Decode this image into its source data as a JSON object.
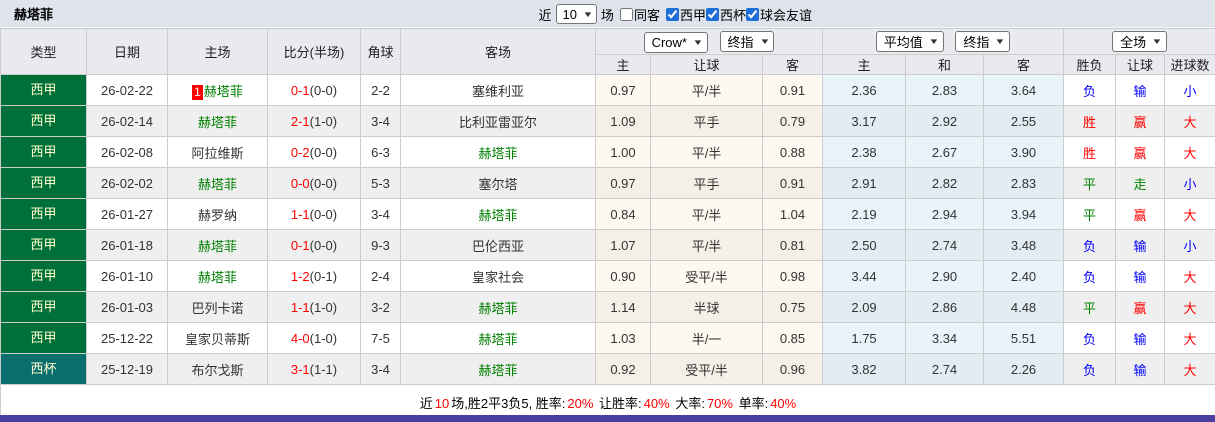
{
  "title": "赫塔菲",
  "filter": {
    "recent_prefix": "近",
    "recent_value": "10",
    "recent_suffix": "场",
    "checkboxes": [
      {
        "label": "同客",
        "checked": false
      },
      {
        "label": "西甲",
        "checked": true
      },
      {
        "label": "西杯",
        "checked": true
      },
      {
        "label": "球会友谊",
        "checked": true
      }
    ]
  },
  "header": {
    "cols": [
      "类型",
      "日期",
      "主场",
      "比分(半场)",
      "角球",
      "客场"
    ],
    "bookmaker_select": "Crow*",
    "final_select_1": "终指",
    "average_select": "平均值",
    "final_select_2": "终指",
    "scope_select": "全场",
    "odds_subcols": [
      "主",
      "让球",
      "客"
    ],
    "avg_subcols": [
      "主",
      "和",
      "客"
    ],
    "result_subcols": [
      "胜负",
      "让球",
      "进球数"
    ]
  },
  "rows": [
    {
      "league": "西甲",
      "league_class": "liga",
      "date": "26-02-22",
      "home": {
        "name": "赫塔菲",
        "target": true,
        "rank": "1"
      },
      "score": {
        "ft": "0-1",
        "ht": "(0-0)"
      },
      "corner": "2-2",
      "away": {
        "name": "塞维利亚",
        "target": false
      },
      "odds": [
        "0.97",
        "平/半",
        "0.91"
      ],
      "avg": [
        "2.36",
        "2.83",
        "3.64"
      ],
      "res": [
        {
          "t": "负",
          "c": "c-blue"
        },
        {
          "t": "输",
          "c": "c-blue"
        },
        {
          "t": "小",
          "c": "c-blue"
        }
      ]
    },
    {
      "league": "西甲",
      "league_class": "liga",
      "date": "26-02-14",
      "home": {
        "name": "赫塔菲",
        "target": true
      },
      "score": {
        "ft": "2-1",
        "ht": "(1-0)"
      },
      "corner": "3-4",
      "away": {
        "name": "比利亚雷亚尔",
        "target": false
      },
      "odds": [
        "1.09",
        "平手",
        "0.79"
      ],
      "avg": [
        "3.17",
        "2.92",
        "2.55"
      ],
      "res": [
        {
          "t": "胜",
          "c": "c-red"
        },
        {
          "t": "赢",
          "c": "c-red"
        },
        {
          "t": "大",
          "c": "c-red"
        }
      ]
    },
    {
      "league": "西甲",
      "league_class": "liga",
      "date": "26-02-08",
      "home": {
        "name": "阿拉维斯",
        "target": false
      },
      "score": {
        "ft": "0-2",
        "ht": "(0-0)"
      },
      "corner": "6-3",
      "away": {
        "name": "赫塔菲",
        "target": true
      },
      "odds": [
        "1.00",
        "平/半",
        "0.88"
      ],
      "avg": [
        "2.38",
        "2.67",
        "3.90"
      ],
      "res": [
        {
          "t": "胜",
          "c": "c-red"
        },
        {
          "t": "赢",
          "c": "c-red"
        },
        {
          "t": "大",
          "c": "c-red"
        }
      ]
    },
    {
      "league": "西甲",
      "league_class": "liga",
      "date": "26-02-02",
      "home": {
        "name": "赫塔菲",
        "target": true
      },
      "score": {
        "ft": "0-0",
        "ht": "(0-0)"
      },
      "corner": "5-3",
      "away": {
        "name": "塞尔塔",
        "target": false
      },
      "odds": [
        "0.97",
        "平手",
        "0.91"
      ],
      "avg": [
        "2.91",
        "2.82",
        "2.83"
      ],
      "res": [
        {
          "t": "平",
          "c": "c-green"
        },
        {
          "t": "走",
          "c": "c-green"
        },
        {
          "t": "小",
          "c": "c-blue"
        }
      ]
    },
    {
      "league": "西甲",
      "league_class": "liga",
      "date": "26-01-27",
      "home": {
        "name": "赫罗纳",
        "target": false
      },
      "score": {
        "ft": "1-1",
        "ht": "(0-0)"
      },
      "corner": "3-4",
      "away": {
        "name": "赫塔菲",
        "target": true
      },
      "odds": [
        "0.84",
        "平/半",
        "1.04"
      ],
      "avg": [
        "2.19",
        "2.94",
        "3.94"
      ],
      "res": [
        {
          "t": "平",
          "c": "c-green"
        },
        {
          "t": "赢",
          "c": "c-red"
        },
        {
          "t": "大",
          "c": "c-red"
        }
      ]
    },
    {
      "league": "西甲",
      "league_class": "liga",
      "date": "26-01-18",
      "home": {
        "name": "赫塔菲",
        "target": true
      },
      "score": {
        "ft": "0-1",
        "ht": "(0-0)"
      },
      "corner": "9-3",
      "away": {
        "name": "巴伦西亚",
        "target": false
      },
      "odds": [
        "1.07",
        "平/半",
        "0.81"
      ],
      "avg": [
        "2.50",
        "2.74",
        "3.48"
      ],
      "res": [
        {
          "t": "负",
          "c": "c-blue"
        },
        {
          "t": "输",
          "c": "c-blue"
        },
        {
          "t": "小",
          "c": "c-blue"
        }
      ]
    },
    {
      "league": "西甲",
      "league_class": "liga",
      "date": "26-01-10",
      "home": {
        "name": "赫塔菲",
        "target": true
      },
      "score": {
        "ft": "1-2",
        "ht": "(0-1)"
      },
      "corner": "2-4",
      "away": {
        "name": "皇家社会",
        "target": false
      },
      "odds": [
        "0.90",
        "受平/半",
        "0.98"
      ],
      "avg": [
        "3.44",
        "2.90",
        "2.40"
      ],
      "res": [
        {
          "t": "负",
          "c": "c-blue"
        },
        {
          "t": "输",
          "c": "c-blue"
        },
        {
          "t": "大",
          "c": "c-red"
        }
      ]
    },
    {
      "league": "西甲",
      "league_class": "liga",
      "date": "26-01-03",
      "home": {
        "name": "巴列卡诺",
        "target": false
      },
      "score": {
        "ft": "1-1",
        "ht": "(1-0)"
      },
      "corner": "3-2",
      "away": {
        "name": "赫塔菲",
        "target": true
      },
      "odds": [
        "1.14",
        "半球",
        "0.75"
      ],
      "avg": [
        "2.09",
        "2.86",
        "4.48"
      ],
      "res": [
        {
          "t": "平",
          "c": "c-green"
        },
        {
          "t": "赢",
          "c": "c-red"
        },
        {
          "t": "大",
          "c": "c-red"
        }
      ]
    },
    {
      "league": "西甲",
      "league_class": "liga",
      "date": "25-12-22",
      "home": {
        "name": "皇家贝蒂斯",
        "target": false
      },
      "score": {
        "ft": "4-0",
        "ht": "(1-0)"
      },
      "corner": "7-5",
      "away": {
        "name": "赫塔菲",
        "target": true
      },
      "odds": [
        "1.03",
        "半/一",
        "0.85"
      ],
      "avg": [
        "1.75",
        "3.34",
        "5.51"
      ],
      "res": [
        {
          "t": "负",
          "c": "c-blue"
        },
        {
          "t": "输",
          "c": "c-blue"
        },
        {
          "t": "大",
          "c": "c-red"
        }
      ]
    },
    {
      "league": "西杯",
      "league_class": "cup",
      "date": "25-12-19",
      "home": {
        "name": "布尔戈斯",
        "target": false
      },
      "score": {
        "ft": "3-1",
        "ht": "(1-1)"
      },
      "corner": "3-4",
      "away": {
        "name": "赫塔菲",
        "target": true
      },
      "odds": [
        "0.92",
        "受平/半",
        "0.96"
      ],
      "avg": [
        "3.82",
        "2.74",
        "2.26"
      ],
      "res": [
        {
          "t": "负",
          "c": "c-blue"
        },
        {
          "t": "输",
          "c": "c-blue"
        },
        {
          "t": "大",
          "c": "c-red"
        }
      ]
    }
  ],
  "summary": {
    "segments": [
      {
        "t": "近",
        "c": "k"
      },
      {
        "t": "10",
        "c": "r"
      },
      {
        "t": "场,胜2平3负5, 胜率:",
        "c": "k"
      },
      {
        "t": "20%",
        "c": "r"
      },
      {
        "t": " 让胜率:",
        "c": "k"
      },
      {
        "t": "40%",
        "c": "r"
      },
      {
        "t": " 大率:",
        "c": "k"
      },
      {
        "t": "70%",
        "c": "r"
      },
      {
        "t": " 单率:",
        "c": "k"
      },
      {
        "t": "40%",
        "c": "r"
      }
    ]
  },
  "colors": {
    "win_red": "#ff0000",
    "lose_blue": "#0000ff",
    "draw_green": "#008000",
    "liga_badge_bg": "#00703a",
    "cup_badge_bg": "#0b6e6e",
    "badge_text": "#ffffcc",
    "bottom_bar": "#4a3e9e"
  }
}
